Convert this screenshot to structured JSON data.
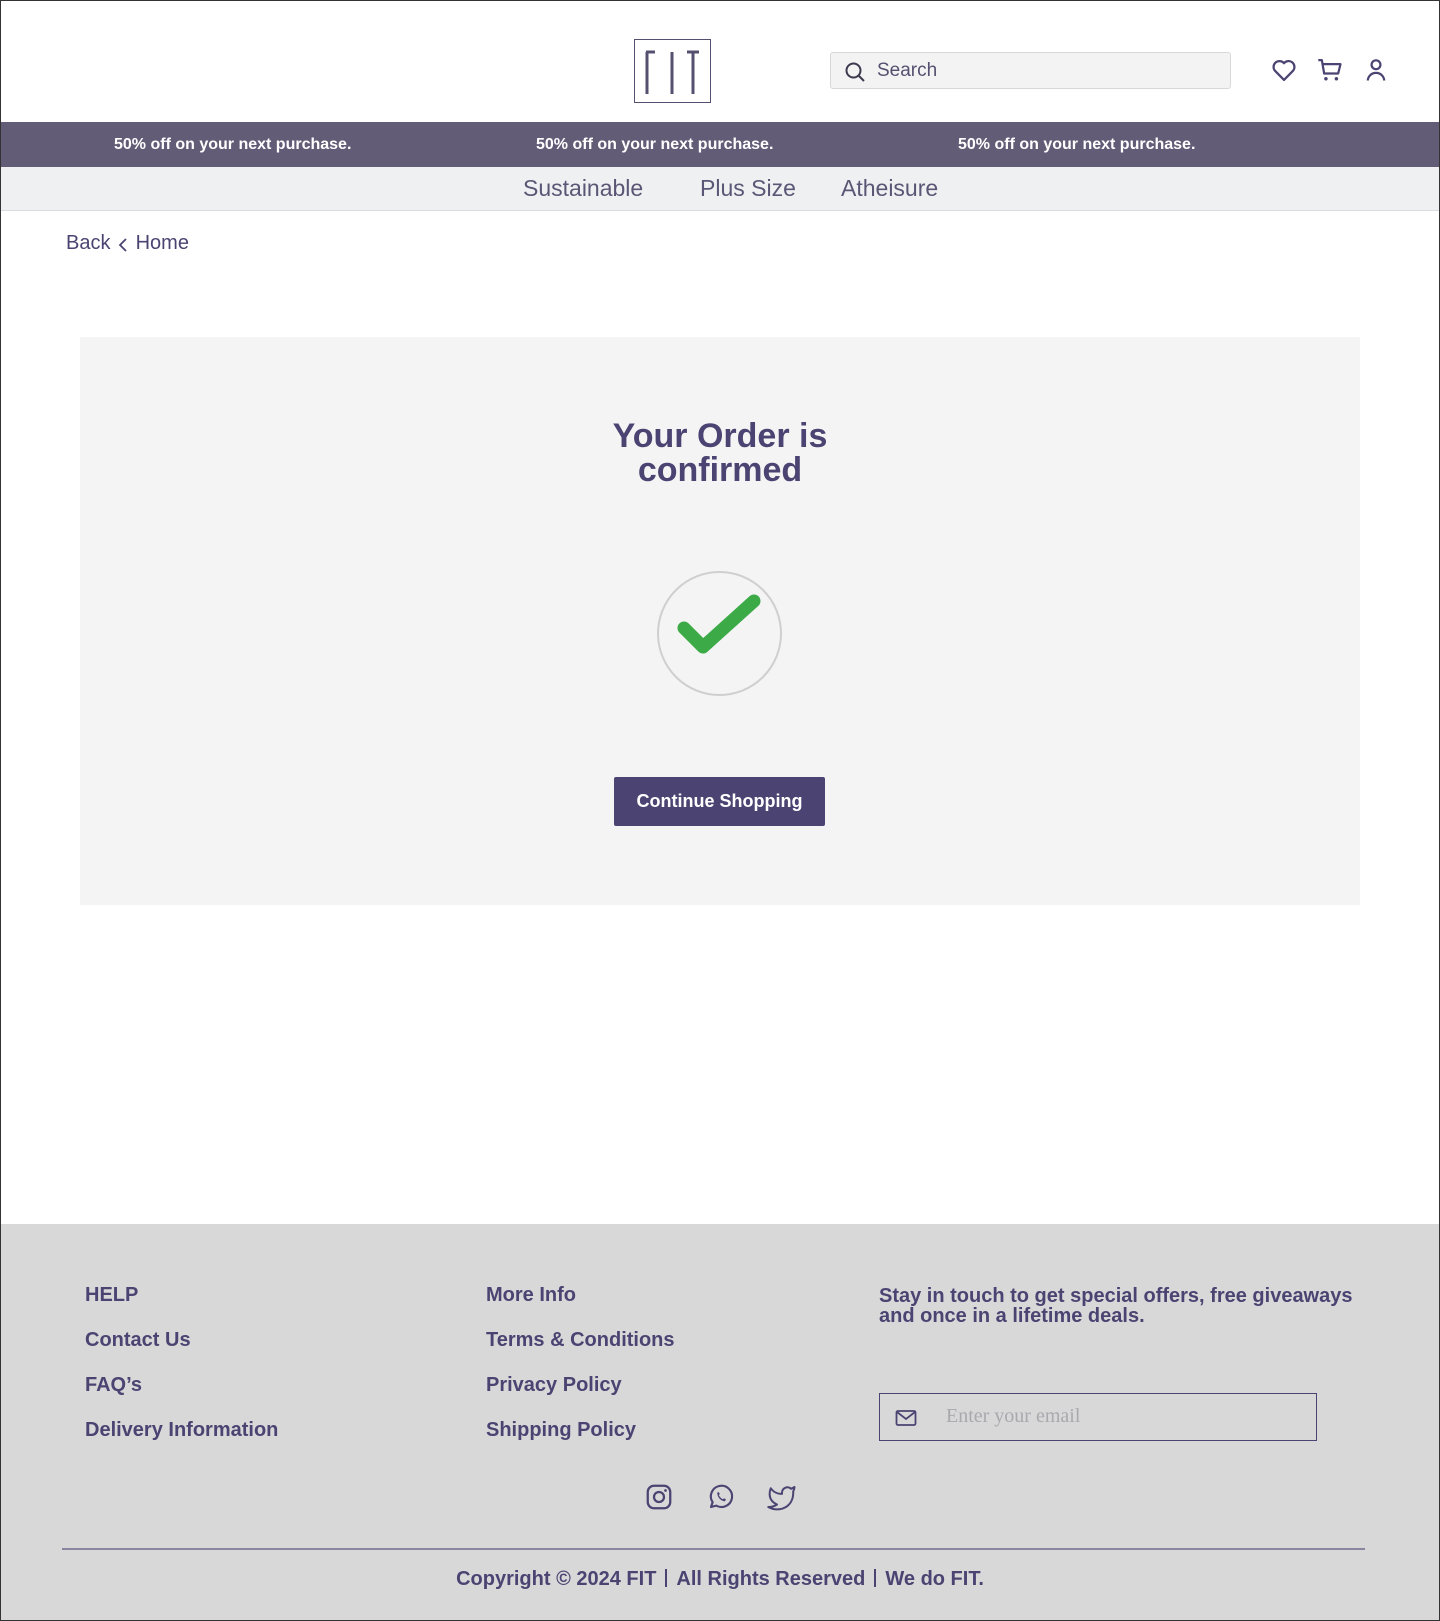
{
  "brand": {
    "logo_text": "FIT"
  },
  "search": {
    "placeholder": "Search"
  },
  "header_icons": [
    "heart-icon",
    "cart-icon",
    "user-icon"
  ],
  "promo": {
    "messages": [
      "50% off on your next purchase.",
      "50% off on your next purchase.",
      "50% off on your next purchase."
    ]
  },
  "categories": [
    "Sustainable",
    "Plus Size",
    "Atheisure"
  ],
  "breadcrumb": {
    "back": "Back",
    "home": "Home"
  },
  "confirmation": {
    "title_line1": "Your Order is",
    "title_line2": "confirmed",
    "button": "Continue Shopping"
  },
  "footer": {
    "help": {
      "heading": "HELP",
      "links": [
        "Contact Us",
        "FAQ’s",
        "Delivery Information"
      ]
    },
    "more": {
      "heading": "More Info",
      "links": [
        "Terms & Conditions",
        "Privacy Policy",
        "Shipping Policy"
      ]
    },
    "newsletter": {
      "line1": "Stay in touch to get special offers, free giveaways",
      "line2": "and once in a lifetime deals.",
      "placeholder": "Enter your email"
    },
    "social": [
      "instagram-icon",
      "whatsapp-icon",
      "twitter-icon"
    ],
    "copyright": {
      "part1": "Copyright © 2024 FIT",
      "part2": "All Rights Reserved",
      "part3": "We do FIT."
    }
  },
  "colors": {
    "brand_purple": "#4b4472",
    "promo_band": "#635c77",
    "success_green": "#3daa48",
    "card_bg": "#f4f4f4",
    "footer_bg": "#d8d8d9"
  }
}
